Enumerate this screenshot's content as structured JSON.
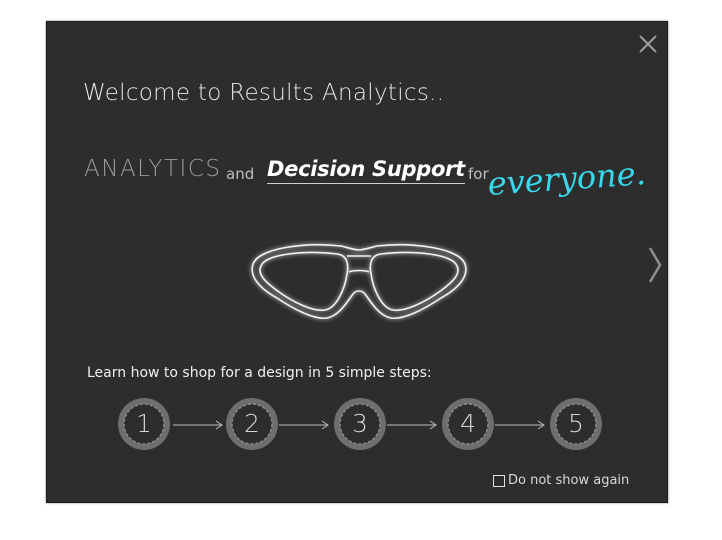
{
  "dialog": {
    "title": "Welcome to Results Analytics..",
    "close_icon": "close-icon",
    "next_icon": "chevron-right-icon"
  },
  "tagline": {
    "analytics": "ANALYTICS",
    "and": "and",
    "decision_support": "Decision Support",
    "for": "for",
    "everyone": "everyone."
  },
  "steps": {
    "label": "Learn how to shop for a design in 5 simple steps:",
    "items": [
      "1",
      "2",
      "3",
      "4",
      "5"
    ]
  },
  "footer": {
    "dont_show_label": "Do not show again",
    "dont_show_checked": false
  },
  "colors": {
    "background": "#2d2d2d",
    "accent": "#38d8ec",
    "glow": "#7fdfe8"
  }
}
